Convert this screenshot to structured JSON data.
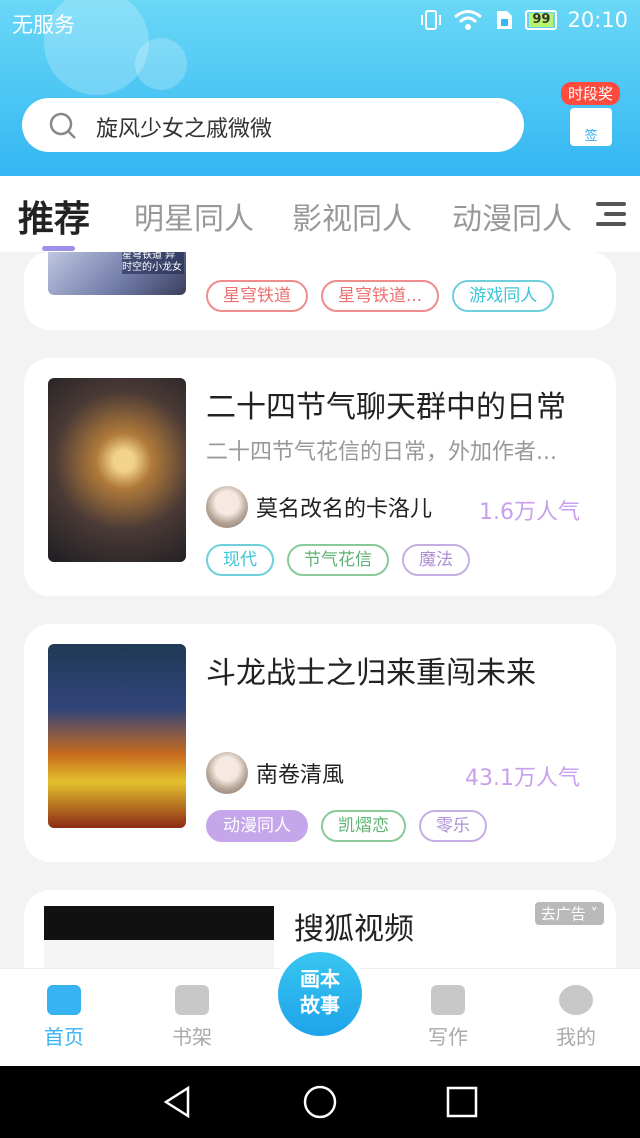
{
  "status_bar": {
    "carrier": "无服务",
    "battery": "99",
    "time": "20:10"
  },
  "search": {
    "placeholder": "旋风少女之戚微微"
  },
  "sign_in": {
    "badge": "时段奖",
    "label": "签"
  },
  "tabs": [
    {
      "label": "推荐",
      "active": true
    },
    {
      "label": "明星同人"
    },
    {
      "label": "影视同人"
    },
    {
      "label": "动漫同人"
    }
  ],
  "books": [
    {
      "cover_text": "星穹铁道 异时空的小龙女",
      "tags": [
        "星穹铁道",
        "星穹铁道...",
        "游戏同人"
      ]
    },
    {
      "title": "二十四节气聊天群中的日常",
      "desc": "二十四节气花信的日常，外加作者...",
      "author": "莫名改名的卡洛儿",
      "popularity": "1.6万人气",
      "tags": [
        "现代",
        "节气花信",
        "魔法"
      ]
    },
    {
      "title": "斗龙战士之归来重闯未来",
      "desc": "",
      "author": "南卷清風",
      "popularity": "43.1万人气",
      "tags": [
        "动漫同人",
        "凯熠恋",
        "零乐"
      ]
    }
  ],
  "ad": {
    "title": "搜狐视频",
    "close_label": "去广告"
  },
  "bottom_nav": {
    "home": "首页",
    "shelf": "书架",
    "center_line1": "画本",
    "center_line2": "故事",
    "write": "写作",
    "mine": "我的"
  },
  "colors": {
    "accent": "#38b3f2",
    "popularity": "#c9a0ec",
    "tab_underline": "#9e8fe8"
  }
}
